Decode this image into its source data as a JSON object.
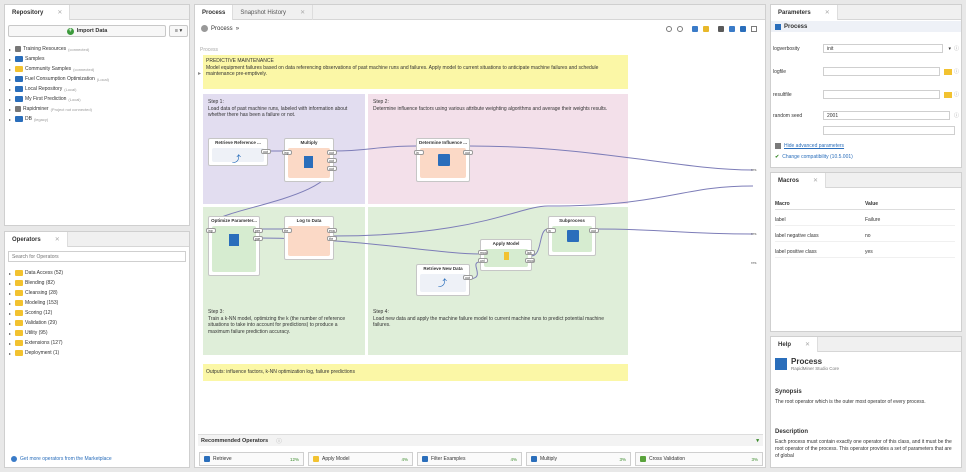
{
  "repository": {
    "tab_label": "Repository",
    "import_button": "Import Data",
    "items": [
      {
        "label": "Training Resources",
        "sub": "(connected)"
      },
      {
        "label": "Samples",
        "sub": ""
      },
      {
        "label": "Community Samples",
        "sub": "(connected)"
      },
      {
        "label": "Fuel Consumption Optimization",
        "sub": "(Local)"
      },
      {
        "label": "Local Repository",
        "sub": "(Local)"
      },
      {
        "label": "My First Prediction",
        "sub": "(Local)"
      },
      {
        "label": "Rapidminer",
        "sub": "(Project not connected)"
      },
      {
        "label": "DB",
        "sub": "(legacy)"
      }
    ]
  },
  "operators": {
    "tab_label": "Operators",
    "search_placeholder": "Search for Operators",
    "items": [
      "Data Access (52)",
      "Blending (82)",
      "Cleansing (28)",
      "Modeling (153)",
      "Scoring (12)",
      "Validation (29)",
      "Utility (95)",
      "Extensions (127)",
      "Deployment (1)"
    ],
    "marketplace_link": "Get more operators from the Marketplace"
  },
  "process": {
    "tabs": [
      "Process",
      "Snapshot History"
    ],
    "breadcrumb": "Process",
    "canvas_label": "Process",
    "top_note_title": "PREDICTIVE MAINTENANCE",
    "top_note_text": "Model equipment failures based on data referencing observations of past machine runs and failures. Apply model to current situations to anticipate machine failures and schedule maintenance pre-emptively.",
    "step1": "Step 1:\nLoad data of past machine runs, labeled with information about whether there has been a failure or not.",
    "step2": "Step 2:\nDetermine influence factors using various attribute weighting algorithms and average their weights results.",
    "step3": "Step 3:\nTrain a k-NN model, optimizing the k (the number of reference situations to take into account for predictions) to produce a maximum failure prediction accuracy.",
    "step4": "Step 4:\nLoad new data and apply the machine failure model to current machine runs to predict potential machine failures.",
    "bottom_note": "Outputs: influence factors, k-NN optimization log, failure predictions",
    "operators": {
      "retrieve_ref": "Retrieve Reference ...",
      "multiply": "Multiply",
      "determine": "Determine Influence ...",
      "optimize": "Optimize Parameter...",
      "log_to_data": "Log to Data",
      "subprocess": "Subprocess",
      "apply_model": "Apply Model",
      "retrieve_new": "Retrieve New Data"
    },
    "ports": {
      "out": "out",
      "inp": "inp",
      "per": "per",
      "par": "par",
      "exa": "exa",
      "res": "res",
      "thr": "thr",
      "in": "in",
      "mod": "mod",
      "unl": "unl",
      "lab": "lab",
      "output": "out"
    },
    "res_labels": [
      "res",
      "res",
      "res"
    ]
  },
  "recommended": {
    "title": "Recommended Operators",
    "items": [
      {
        "label": "Retrieve",
        "pct": "12%"
      },
      {
        "label": "Apply Model",
        "pct": "4%"
      },
      {
        "label": "Filter Examples",
        "pct": "4%"
      },
      {
        "label": "Multiply",
        "pct": "3%"
      },
      {
        "label": "Cross Validation",
        "pct": "3%"
      }
    ]
  },
  "parameters": {
    "tab_label": "Parameters",
    "header": "Process",
    "rows": [
      {
        "label": "logverbosity",
        "value": "init"
      },
      {
        "label": "logfile",
        "value": ""
      },
      {
        "label": "resultfile",
        "value": ""
      },
      {
        "label": "random seed",
        "value": "2001"
      },
      {
        "label": "",
        "value": ""
      }
    ],
    "hide_advanced": "Hide advanced parameters",
    "compatibility": "Change compatibility (10.5.001)"
  },
  "macros": {
    "tab_label": "Macros",
    "col_macro": "Macro",
    "col_value": "Value",
    "rows": [
      {
        "name": "label",
        "value": "Failure"
      },
      {
        "name": "label negative class",
        "value": "no"
      },
      {
        "name": "label positive class",
        "value": "yes"
      }
    ]
  },
  "help": {
    "tab_label": "Help",
    "title": "Process",
    "subtitle": "RapidMiner Studio Core",
    "synopsis_heading": "Synopsis",
    "synopsis_text": "The root operator which is the outer most operator of every process.",
    "description_heading": "Description",
    "description_text": "Each process must contain exactly one operator of this class, and it must be the root operator of the process. This operator provides a set of parameters that are of global"
  }
}
